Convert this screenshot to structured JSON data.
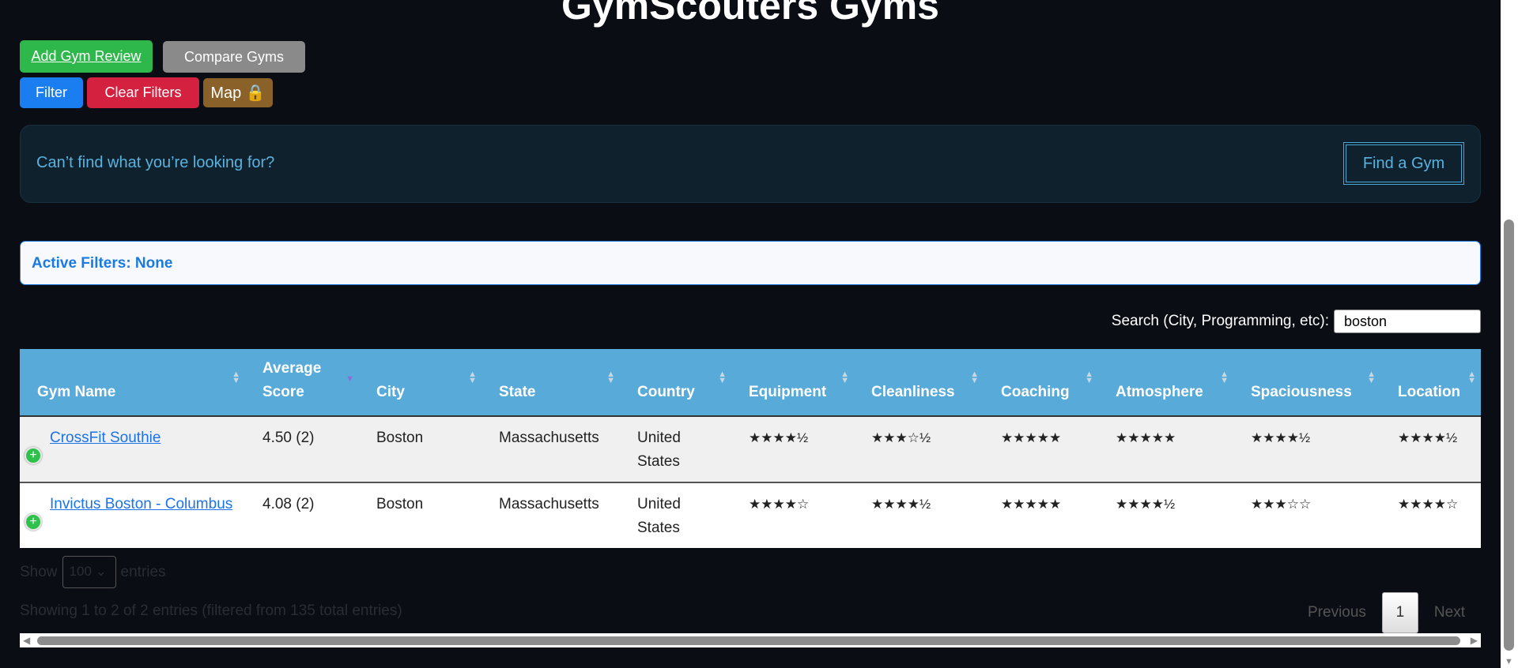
{
  "title": "GymScouters Gyms",
  "buttons": {
    "add_review": "Add Gym Review",
    "compare": "Compare Gyms",
    "filter": "Filter",
    "clear_filters": "Clear Filters",
    "map": "Map 🔒"
  },
  "colors": {
    "add": "#2eb84c",
    "compare": "#8a8a8a",
    "filter": "#1a7ef0",
    "clear": "#d4213f",
    "map": "#8a6128",
    "header": "#58aad8"
  },
  "banner": {
    "text": "Can’t find what you’re looking for?",
    "button": "Find a Gym"
  },
  "active_filters": "Active Filters: None",
  "search": {
    "label": "Search (City, Programming, etc):",
    "value": "boston"
  },
  "table": {
    "columns": [
      "Gym Name",
      "Average Score",
      "City",
      "State",
      "Country",
      "Equipment",
      "Cleanliness",
      "Coaching",
      "Atmosphere",
      "Spaciousness",
      "Location"
    ],
    "rows": [
      {
        "name": "CrossFit Southie",
        "score": "4.50 (2)",
        "city": "Boston",
        "state": "Massachusetts",
        "country": "United States",
        "equipment": "★★★★½",
        "cleanliness": "★★★☆½",
        "coaching": "★★★★★",
        "atmosphere": "★★★★★",
        "spaciousness": "★★★★½",
        "location": "★★★★½"
      },
      {
        "name": "Invictus Boston - Columbus",
        "score": "4.08 (2)",
        "city": "Boston",
        "state": "Massachusetts",
        "country": "United States",
        "equipment": "★★★★☆",
        "cleanliness": "★★★★½",
        "coaching": "★★★★★",
        "atmosphere": "★★★★½",
        "spaciousness": "★★★☆☆",
        "location": "★★★★☆"
      }
    ]
  },
  "length": {
    "show": "Show",
    "value": "100",
    "entries": "entries"
  },
  "info": "Showing 1 to 2 of 2 entries (filtered from 135 total entries)",
  "pagination": {
    "previous": "Previous",
    "current": "1",
    "next": "Next"
  }
}
